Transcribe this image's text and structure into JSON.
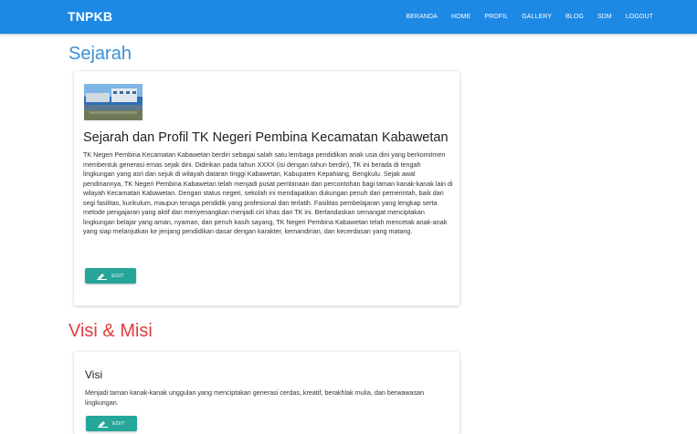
{
  "navbar": {
    "brand": "TNPKB",
    "links": [
      {
        "label": "BERANDA"
      },
      {
        "label": "HOME"
      },
      {
        "label": "PROFIL"
      },
      {
        "label": "GALLERY"
      },
      {
        "label": "BLOG"
      },
      {
        "label": "SDM"
      },
      {
        "label": "LOGOUT"
      }
    ],
    "color": "#1e88e5"
  },
  "sections": {
    "sejarah": {
      "title": "Sejarah",
      "title_color": "#3a8fd8",
      "card": {
        "image_icon": "school-building-photo",
        "heading": "Sejarah dan Profil TK Negeri Pembina Kecamatan Kabawetan",
        "body": "TK Negeri Pembina Kecamatan Kabawetan berdiri sebagai salah satu lembaga pendidikan anak usia dini yang berkomitmen membentuk generasi emas sejak dini. Didirikan pada tahun XXXX (isi dengan tahun berdiri), TK ini berada di tengah lingkungan yang asri dan sejuk di wilayah dataran tinggi Kabawetan, Kabupaten Kepahiang, Bengkulu. Sejak awal pendiriannya, TK Negeri Pembina Kabawetan telah menjadi pusat pembinaan dan percontohan bagi taman kanak-kanak lain di wilayah Kecamatan Kabawetan. Dengan status negeri, sekolah ini mendapatkan dukungan penuh dari pemerintah, baik dari segi fasilitas, kurikulum, maupun tenaga pendidik yang profesional dan terlatih. Fasilitas pembelajaran yang lengkap serta metode pengajaran yang aktif dan menyenangkan menjadi ciri khas dari TK ini. Berlandaskan semangat menciptakan lingkungan belajar yang aman, nyaman, dan penuh kasih sayang, TK Negeri Pembina Kabawetan telah mencetak anak-anak yang siap melanjutkan ke jenjang pendidikan dasar dengan karakter, kemandirian, dan kecerdasan yang matang.",
        "edit_label": "EDIT",
        "edit_icon": "pencil-icon"
      }
    },
    "visi_misi": {
      "title": "Visi & Misi",
      "title_color": "#e23b3b",
      "card": {
        "heading": "Visi",
        "body": "Menjadi taman kanak-kanak unggulan yang menciptakan generasi cerdas, kreatif, berakhlak mulia, dan berwawasan lingkungan.",
        "edit_label": "EDIT",
        "edit_icon": "pencil-icon"
      }
    }
  },
  "accent_colors": {
    "edit_button": "#26a69a"
  }
}
